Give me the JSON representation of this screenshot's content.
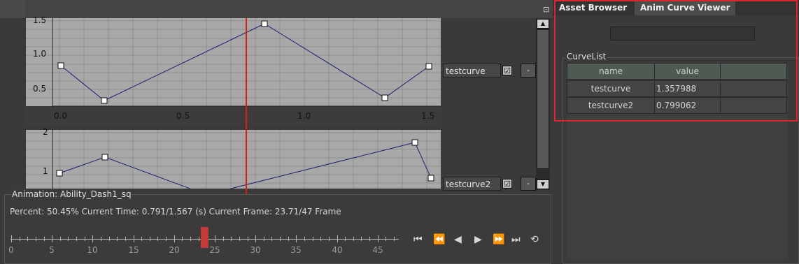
{
  "graph1": {
    "y_ticks": [
      "1.5",
      "1.0",
      "0.5"
    ],
    "x_ticks": [
      "0.0",
      "0.5",
      "1.0",
      "1.5"
    ]
  },
  "graph2": {
    "y_ticks": [
      "2",
      "1"
    ]
  },
  "curves": [
    {
      "name": "testcurve",
      "checked": "☑",
      "remove_label": "-"
    },
    {
      "name": "testcurve2",
      "checked": "☑",
      "remove_label": "-"
    }
  ],
  "animation": {
    "title": "Animation: Ability_Dash1_sq",
    "status": "Percent: 50.45% Current Time: 0.791/1.567 (s) Current Frame: 23.71/47 Frame",
    "timeline_ticks": [
      "0",
      "5",
      "10",
      "15",
      "20",
      "25",
      "30",
      "35",
      "40",
      "45"
    ],
    "current_frame": 23.71,
    "total_frames": 47
  },
  "controls": {
    "first": "⏮",
    "prev_key": "⏪",
    "prev": "◀",
    "play": "▶",
    "next_key": "⏩",
    "last": "⏭",
    "loop": "⟲"
  },
  "right_panel": {
    "tabs": [
      "Asset Browser",
      "Anim Curve Viewer"
    ],
    "active_tab": "Anim Curve Viewer",
    "curve_list_title": "CurveList",
    "columns": [
      "name",
      "value",
      ""
    ],
    "rows": [
      {
        "name": "testcurve",
        "value": "1.357988"
      },
      {
        "name": "testcurve2",
        "value": "0.799062"
      }
    ]
  },
  "colors": {
    "playhead": "#e01818",
    "curve_line": "#1a2270",
    "highlight_border": "#e0242c",
    "timeline_marker": "#c23a3a"
  }
}
